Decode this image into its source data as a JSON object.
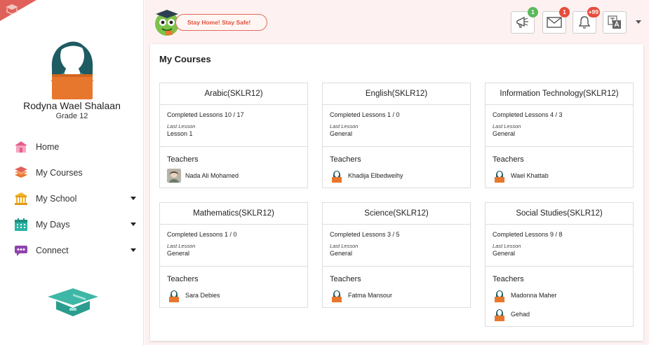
{
  "user": {
    "name": "Rodyna Wael Shalaan",
    "grade": "Grade 12"
  },
  "nav": [
    {
      "label": "Home",
      "icon": "house-icon",
      "has_dropdown": false
    },
    {
      "label": "My Courses",
      "icon": "books-icon",
      "has_dropdown": false
    },
    {
      "label": "My School",
      "icon": "school-building-icon",
      "has_dropdown": true
    },
    {
      "label": "My Days",
      "icon": "calendar-icon",
      "has_dropdown": true
    },
    {
      "label": "Connect",
      "icon": "chat-connect-icon",
      "has_dropdown": true
    }
  ],
  "topbar": {
    "banner": "Stay Home! Stay Safe!",
    "announcements_count": "1",
    "messages_count": "1",
    "notifications_count": "+99"
  },
  "main": {
    "title": "My Courses",
    "teachers_label": "Teachers",
    "last_lesson_label": "Last Lesson",
    "courses": [
      {
        "name": "Arabic(SKLR12)",
        "completed": "Completed Lessons 10 / 17",
        "last_lesson": "Lesson 1",
        "teachers": [
          "Nada Ali Mohamed"
        ]
      },
      {
        "name": "English(SKLR12)",
        "completed": "Completed Lessons 1 / 0",
        "last_lesson": "General",
        "teachers": [
          "Khadija Elbedweihy"
        ]
      },
      {
        "name": "Information Technology(SKLR12)",
        "completed": "Completed Lessons 4 / 3",
        "last_lesson": "General",
        "teachers": [
          "Wael Khattab"
        ]
      },
      {
        "name": "Mathematics(SKLR12)",
        "completed": "Completed Lessons 1 / 0",
        "last_lesson": "General",
        "teachers": [
          "Sara Debies"
        ]
      },
      {
        "name": "Science(SKLR12)",
        "completed": "Completed Lessons 3 / 5",
        "last_lesson": "General",
        "teachers": [
          "Fatma Mansour"
        ]
      },
      {
        "name": "Social Studies(SKLR12)",
        "completed": "Completed Lessons 9 / 8",
        "last_lesson": "General",
        "teachers": [
          "Madonna Maher",
          "Gehad"
        ]
      }
    ]
  },
  "colors": {
    "accent_red": "#e74c3c",
    "badge_green": "#5cb85c",
    "topbar_bg": "#fdf1f1",
    "avatar_teal": "#1e5b63",
    "avatar_orange": "#e8772e"
  }
}
